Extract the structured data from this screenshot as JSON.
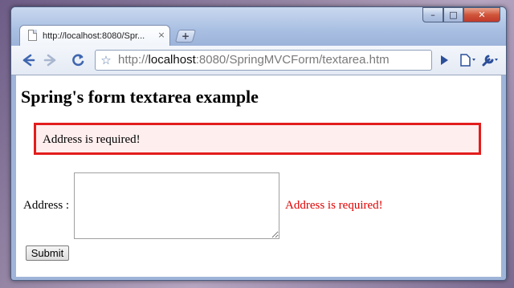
{
  "browser": {
    "tab_title": "http://localhost:8080/Spr...",
    "tab_close": "×",
    "new_tab": "+",
    "window_buttons": {
      "minimize": "–",
      "maximize": "□",
      "close": "✕"
    },
    "url_prefix": "http://",
    "url_host": "localhost",
    "url_rest": ":8080/SpringMVCForm/textarea.htm",
    "icons": [
      "back-icon",
      "forward-icon",
      "reload-icon",
      "star-icon",
      "play-icon",
      "page-icon",
      "wrench-icon"
    ]
  },
  "page": {
    "heading": "Spring's form textarea example",
    "error_summary": "Address is required!",
    "address_label": "Address :",
    "address_value": "",
    "address_error": "Address is required!",
    "submit_label": "Submit"
  },
  "colors": {
    "error_border": "#e31d1d",
    "error_background": "#ffeeee",
    "error_text": "#e00000"
  }
}
